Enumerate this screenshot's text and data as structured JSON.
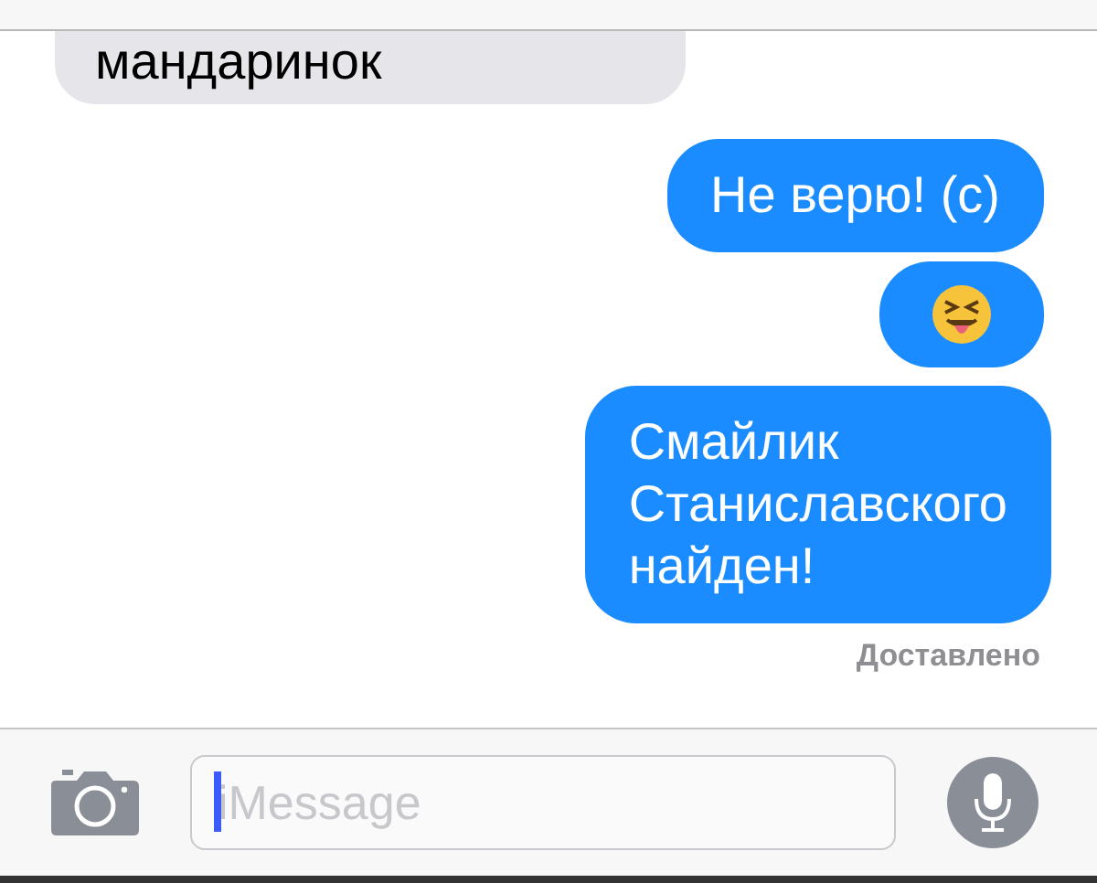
{
  "messages": [
    {
      "kind": "text",
      "outgoing": false,
      "text": "мандаринок"
    },
    {
      "kind": "text",
      "outgoing": true,
      "text": "Не верю! (с)"
    },
    {
      "kind": "emoji",
      "outgoing": true
    },
    {
      "kind": "text",
      "outgoing": true,
      "text": "Смайлик\nСтаниславского\nнайден!"
    }
  ],
  "status": "Доставлено",
  "composer": {
    "placeholder": "iMessage",
    "focused": true
  }
}
